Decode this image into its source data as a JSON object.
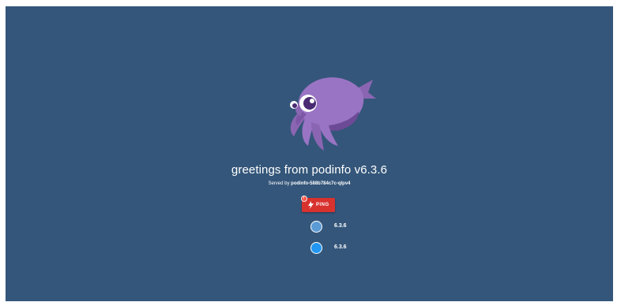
{
  "app": {
    "title": "greetings from podinfo v6.3.6",
    "served_by_prefix": "Served by ",
    "hostname": "podinfo-588b784c7c-qlpv4",
    "mascot_icon": "cuttlefish-logo-icon",
    "background_color": "#34567a"
  },
  "ping_button": {
    "label": "PING",
    "icon": "lightning-bolt-icon",
    "badge": "!",
    "color": "#d8322f"
  },
  "instances": [
    {
      "version": "6.3.6",
      "color": "#5b9bd5"
    },
    {
      "version": "6.3.6",
      "color": "#2196f3"
    }
  ]
}
